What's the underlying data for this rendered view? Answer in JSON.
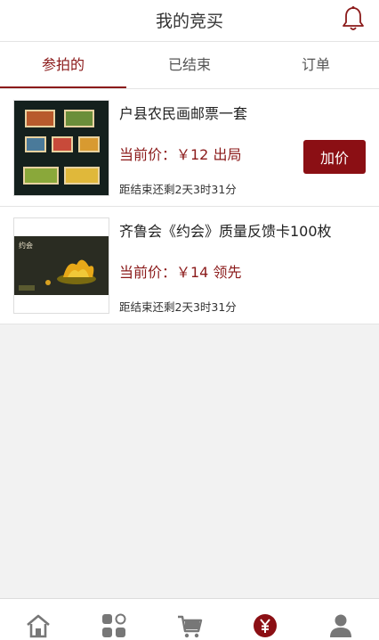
{
  "header": {
    "title": "我的竞买",
    "bell_icon": "bell-icon"
  },
  "tabs": [
    {
      "label": "参拍的",
      "active": true
    },
    {
      "label": "已结束",
      "active": false
    },
    {
      "label": "订单",
      "active": false
    }
  ],
  "items": [
    {
      "name": "户县农民画邮票一套",
      "price": "当前价：￥12 出局",
      "remaining": "距结束还剩2天3时31分",
      "bid_label": "加价"
    },
    {
      "name": "齐鲁会《约会》质量反馈卡100枚",
      "price": "当前价：￥14 领先",
      "remaining": "距结束还剩2天3时31分",
      "thumb_text": "约会"
    }
  ],
  "bottom_nav": [
    {
      "icon": "home-icon",
      "active": false
    },
    {
      "icon": "category-icon",
      "active": false
    },
    {
      "icon": "cart-icon",
      "active": false
    },
    {
      "icon": "yuan-icon",
      "active": true
    },
    {
      "icon": "user-icon",
      "active": false
    }
  ],
  "colors": {
    "accent": "#8b1a1a",
    "button": "#8b0f14",
    "background": "#f2f2f2"
  }
}
